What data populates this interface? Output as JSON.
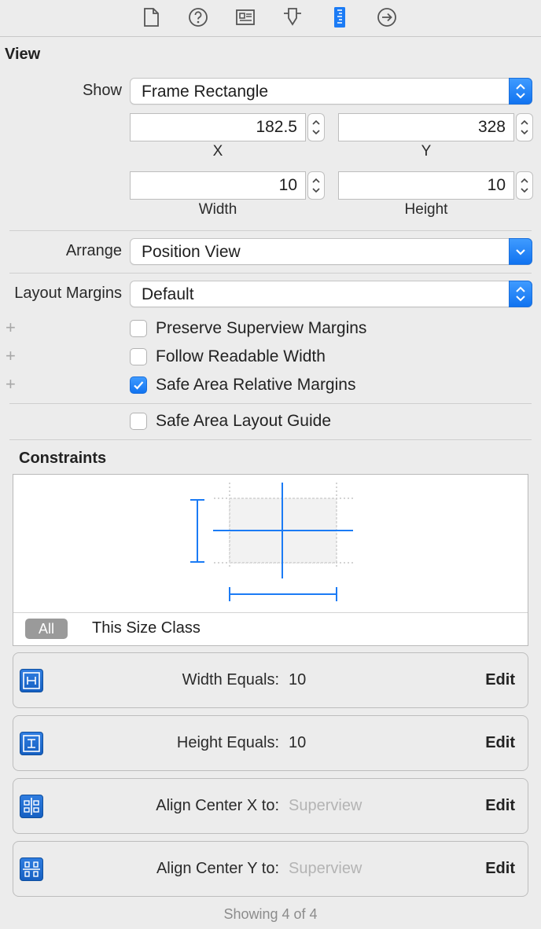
{
  "toolbar": {
    "icons": [
      "file-icon",
      "help-icon",
      "identity-icon",
      "attributes-icon",
      "size-icon",
      "connections-icon"
    ],
    "active": "size-icon",
    "accent": "#1b7bf5"
  },
  "view": {
    "title": "View",
    "show_label": "Show",
    "show_value": "Frame Rectangle",
    "x_value": "182.5",
    "x_label": "X",
    "y_value": "328",
    "y_label": "Y",
    "width_value": "10",
    "width_label": "Width",
    "height_value": "10",
    "height_label": "Height",
    "arrange_label": "Arrange",
    "arrange_value": "Position View",
    "layout_margins_label": "Layout Margins",
    "layout_margins_value": "Default",
    "plus_symbol": "+",
    "checks": [
      {
        "label": "Preserve Superview Margins",
        "checked": false
      },
      {
        "label": "Follow Readable Width",
        "checked": false
      },
      {
        "label": "Safe Area Relative Margins",
        "checked": true
      }
    ],
    "safe_area_layout_guide": {
      "label": "Safe Area Layout Guide",
      "checked": false
    }
  },
  "constraints": {
    "title": "Constraints",
    "segment_all": "All",
    "segment_size_class": "This Size Class",
    "items": [
      {
        "name": "Width Equals:",
        "value": "10",
        "edit": "Edit",
        "icon": "width-constraint-icon"
      },
      {
        "name": "Height Equals:",
        "value": "10",
        "edit": "Edit",
        "icon": "height-constraint-icon"
      },
      {
        "name": "Align Center X to:",
        "value": "Superview",
        "edit": "Edit",
        "icon": "center-x-constraint-icon"
      },
      {
        "name": "Align Center Y to:",
        "value": "Superview",
        "edit": "Edit",
        "icon": "center-y-constraint-icon"
      }
    ],
    "footer": "Showing 4 of 4"
  }
}
